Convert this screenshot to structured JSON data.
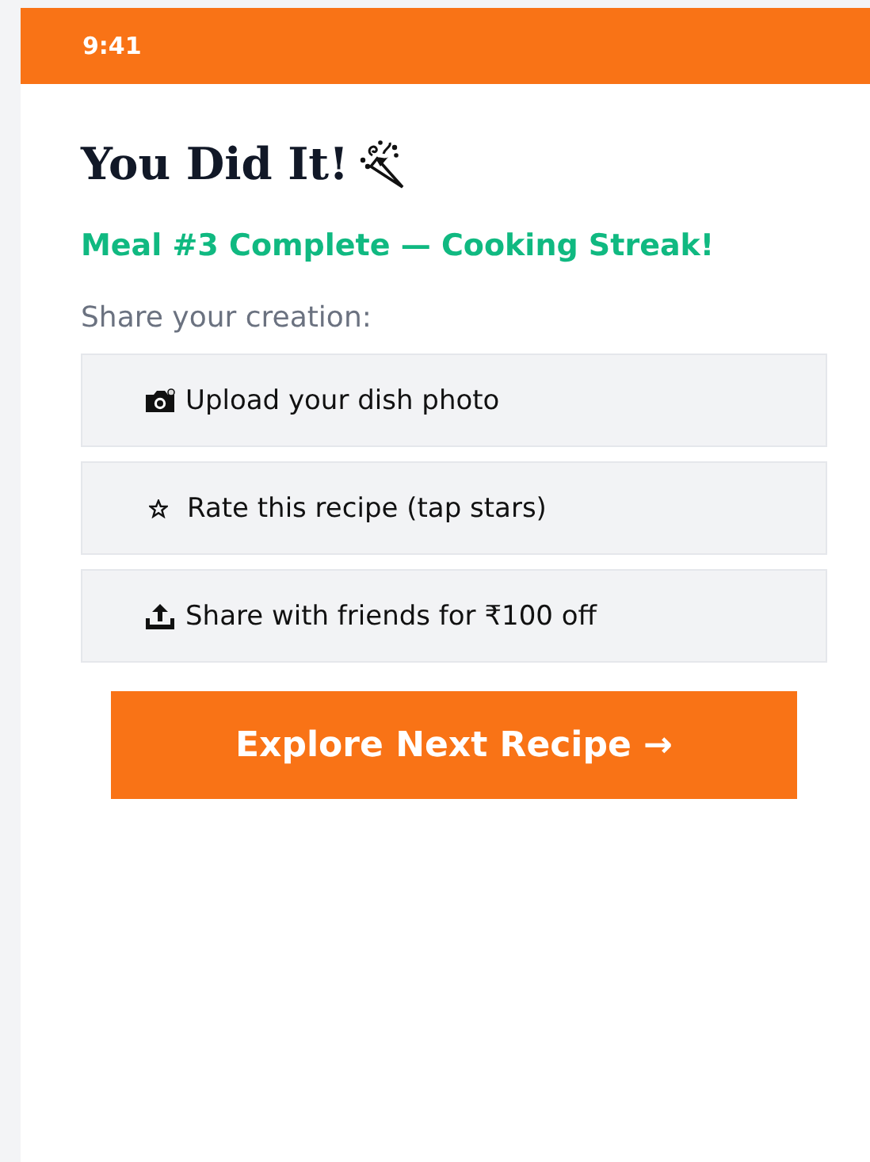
{
  "status_bar": {
    "time": "9:41"
  },
  "title": "You Did It!",
  "subtitle": "Meal #3 Complete — Cooking Streak!",
  "prompt": "Share your creation:",
  "options": [
    {
      "kind": "photo",
      "label": "Upload your dish photo"
    },
    {
      "kind": "rate",
      "label": "Rate this recipe (tap stars)"
    },
    {
      "kind": "share",
      "label": "Share with friends for ₹100 off"
    }
  ],
  "primary_button": "Explore Next Recipe →"
}
